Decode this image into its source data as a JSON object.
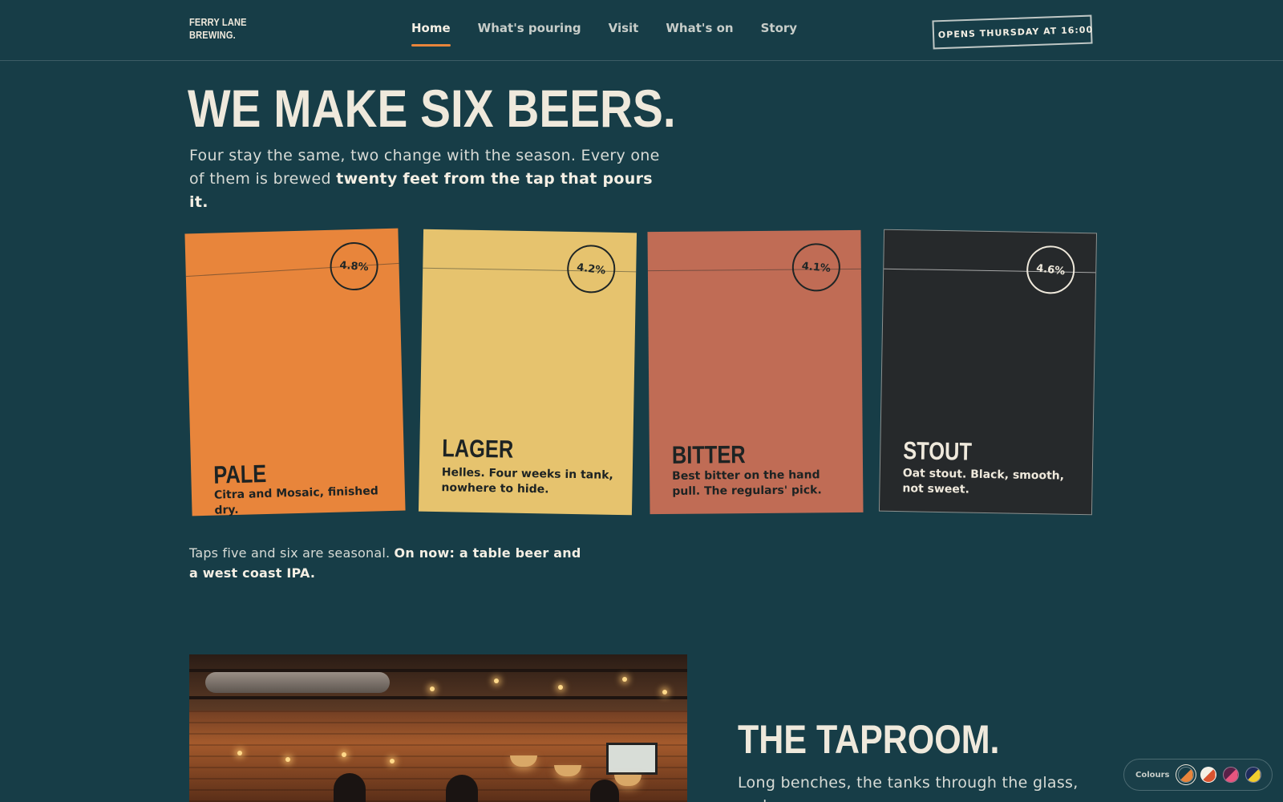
{
  "brand": {
    "line1": "FERRY LANE",
    "line2": "BREWING."
  },
  "nav": [
    {
      "label": "Home",
      "active": true
    },
    {
      "label": "What's pouring",
      "active": false
    },
    {
      "label": "Visit",
      "active": false
    },
    {
      "label": "What's on",
      "active": false
    },
    {
      "label": "Story",
      "active": false
    }
  ],
  "opens_badge": "OPENS THURSDAY AT 16:00",
  "hero": {
    "title": "WE MAKE SIX BEERS.",
    "sub_plain": "Four stay the same, two change with the season. Every one of them is brewed ",
    "sub_bold": "twenty feet from the tap that pours it."
  },
  "beers": [
    {
      "name": "PALE",
      "abv": "4.8%",
      "desc": "Citra and Mosaic, finished dry.",
      "color": "#e8853b"
    },
    {
      "name": "LAGER",
      "abv": "4.2%",
      "desc": "Helles. Four weeks in tank, nowhere to hide.",
      "color": "#e6c36e"
    },
    {
      "name": "BITTER",
      "abv": "4.1%",
      "desc": "Best bitter on the hand pull. The regulars' pick.",
      "color": "#c06c55"
    },
    {
      "name": "STOUT",
      "abv": "4.6%",
      "desc": "Oat stout. Black, smooth, not sweet.",
      "color": "#26292b"
    }
  ],
  "seasonal": {
    "plain": "Taps five and six are seasonal. ",
    "bold": "On now: a table beer and a west coast IPA."
  },
  "taproom": {
    "title": "THE TAPROOM.",
    "text": "Long benches, the tanks through the glass, and a"
  },
  "colours_widget": {
    "label": "Colours",
    "swatches": [
      {
        "name": "teal-orange",
        "a": "#173d47",
        "b": "#e8853b"
      },
      {
        "name": "cream-red",
        "a": "#f4efe4",
        "b": "#d9532f"
      },
      {
        "name": "plum-pink",
        "a": "#5a2148",
        "b": "#e9557f"
      },
      {
        "name": "navy-yellow",
        "a": "#1e2b5c",
        "b": "#f2cd2e"
      }
    ]
  },
  "colors": {
    "background": "#173d47",
    "accent": "#e8853b",
    "text": "#efe9dc"
  }
}
